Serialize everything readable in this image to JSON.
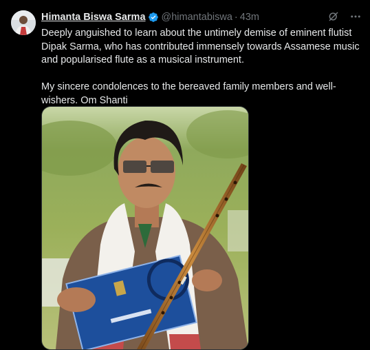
{
  "tweet": {
    "author_name": "Himanta Biswa Sarma",
    "handle": "@himantabiswa",
    "separator": "·",
    "time": "43m",
    "paragraph1": "Deeply anguished to learn about the untimely demise of eminent flutist Dipak Sarma, who has contributed immensely towards Assamese music and popularised flute as a musical instrument.",
    "paragraph2": "My sincere condolences to the bereaved family members and well-wishers. Om Shanti"
  },
  "icons": {
    "verified": "verified-badge-icon",
    "grok": "grok-icon",
    "more": "more-icon"
  },
  "colors": {
    "background": "#000000",
    "text": "#e7e9ea",
    "muted": "#71767b",
    "verified": "#1d9bf0"
  }
}
